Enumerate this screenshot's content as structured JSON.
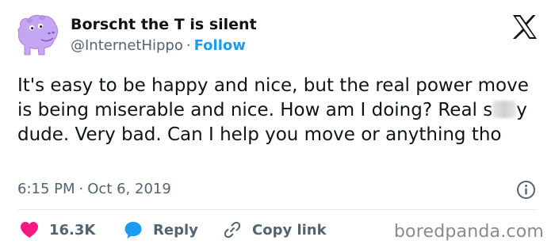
{
  "author": {
    "display_name": "Borscht the T is silent",
    "handle": "@InternetHippo",
    "separator": "·",
    "follow_label": "Follow"
  },
  "tweet": {
    "text_before": "It's easy to be happy and nice, but the real power move is being miserable and nice. How am I doing? Real s",
    "text_after": "y dude. Very bad. Can I help you move or anything tho",
    "time": "6:15 PM",
    "date": "Oct 6, 2019",
    "separator": "·"
  },
  "actions": {
    "like_count": "16.3K",
    "reply_label": "Reply",
    "copy_link_label": "Copy link"
  },
  "watermark": "boredpanda.com",
  "colors": {
    "text": "#0f1419",
    "secondary_text": "#536471",
    "accent_blue": "#1d9bf0",
    "like_pink": "#f91880",
    "avatar_purple": "#c5a6f2"
  },
  "icons": [
    "hippo-avatar",
    "x-logo-icon",
    "info-icon",
    "heart-icon",
    "reply-bubble-icon",
    "link-icon"
  ]
}
